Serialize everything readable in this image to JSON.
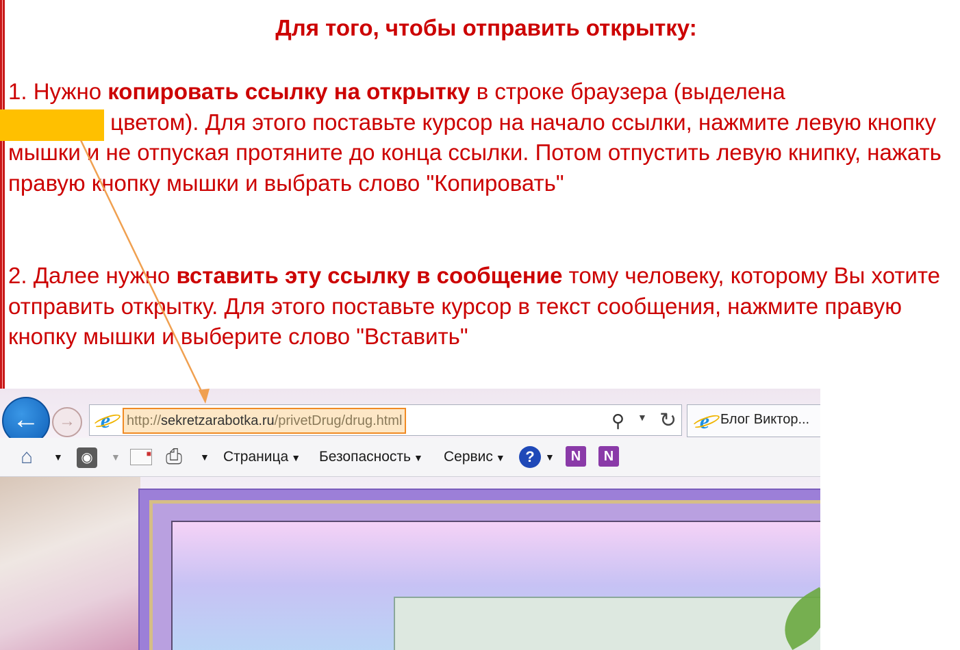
{
  "instruction": {
    "heading": "Для того, чтобы отправить открытку:",
    "step1_a": "1. Нужно ",
    "step1_bold": "копировать ссылку на открытку",
    "step1_b": " в строке браузера (выделена ",
    "step1_c": " цветом). Для этого поставьте курсор на начало ссылки, нажмите левую кнопку мышки и не отпуская протяните до конца ссылки. Потом отпустить левую книпку, нажать правую кнопку мышки и выбрать слово \"Копировать\"",
    "step2_a": "2. Далее нужно ",
    "step2_bold": "вставить эту ссылку в сообщение",
    "step2_b": " тому человеку, которому Вы хотите отправить открытку. Для этого поставьте курсор в текст сообщения, нажмите правую кнопку мышки и выберите слово \"Вставить\""
  },
  "colors": {
    "text": "#cc0000",
    "highlight": "#ffc000",
    "arrow": "#f0a050",
    "url_outline": "#f08a24"
  },
  "browser": {
    "back_icon": "arrow-left-icon",
    "forward_icon": "arrow-right-icon",
    "url": {
      "scheme": "http://",
      "host": "sekretzarabotka.ru",
      "path": "/privetDrug/drug.html"
    },
    "tab_title": "Блог Виктор..."
  },
  "command_bar": {
    "page": "Страница",
    "security": "Безопасность",
    "tools": "Сервис"
  }
}
